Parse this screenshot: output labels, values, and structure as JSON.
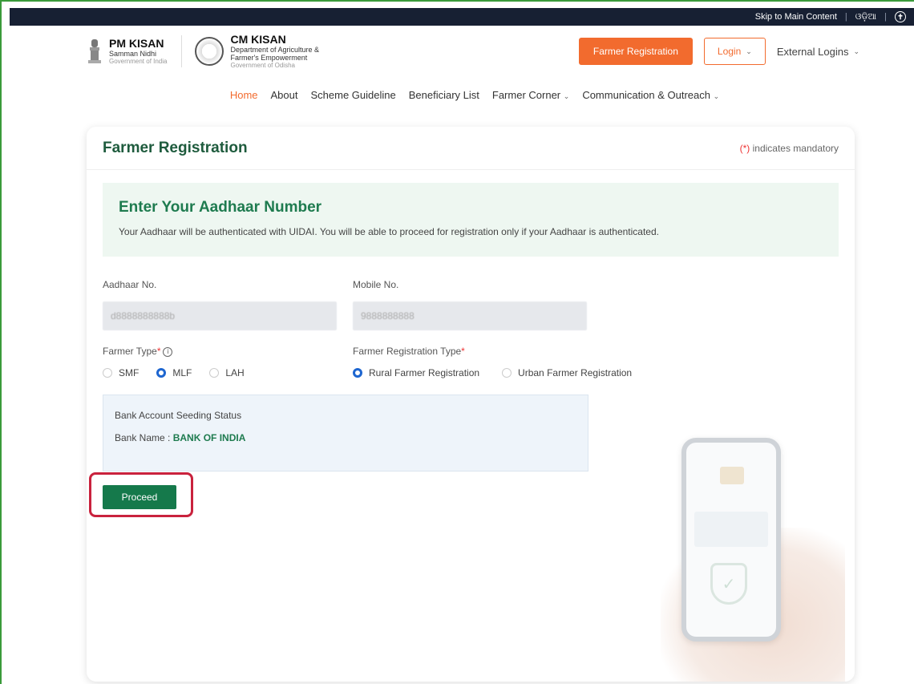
{
  "topbar": {
    "skip": "Skip to Main Content",
    "lang": "ଓଡ଼ିଆ",
    "accessibility_icon": "accessibility-icon"
  },
  "header": {
    "pm_title": "PM KISAN",
    "pm_sub1": "Samman Nidhi",
    "pm_sub2": "Government of India",
    "cm_title": "CM KISAN",
    "cm_sub1": "Department of Agriculture &",
    "cm_sub2": "Farmer's Empowerment",
    "cm_sub3": "Government of Odisha",
    "farmer_registration": "Farmer Registration",
    "login": "Login",
    "external_logins": "External Logins"
  },
  "nav": {
    "items": [
      "Home",
      "About",
      "Scheme Guideline",
      "Beneficiary List",
      "Farmer Corner",
      "Communication & Outreach"
    ]
  },
  "card": {
    "title": "Farmer Registration",
    "mandatory_star": "(*)",
    "mandatory_text": "indicates mandatory",
    "info_title": "Enter Your Aadhaar Number",
    "info_text": "Your Aadhaar will be authenticated with UIDAI. You will be able to proceed for registration only if your Aadhaar is authenticated."
  },
  "form": {
    "aadhaar_label": "Aadhaar No.",
    "aadhaar_value": "d8888888888b",
    "mobile_label": "Mobile No.",
    "mobile_value": "9888888888",
    "farmer_type_label": "Farmer Type",
    "farmer_types": [
      "SMF",
      "MLF",
      "LAH"
    ],
    "farmer_type_selected": "MLF",
    "reg_type_label": "Farmer Registration Type",
    "reg_types": [
      "Rural Farmer Registration",
      "Urban Farmer Registration"
    ],
    "reg_type_selected": "Rural Farmer Registration",
    "bank_status_label": "Bank Account Seeding Status",
    "bank_name_label": "Bank Name : ",
    "bank_name_value": "BANK OF INDIA",
    "proceed": "Proceed"
  },
  "colors": {
    "accent_orange": "#f26b2e",
    "primary_green": "#15794b",
    "title_green": "#1e5b3d",
    "highlight_red": "#c9223d",
    "topbar_navy": "#172033"
  }
}
